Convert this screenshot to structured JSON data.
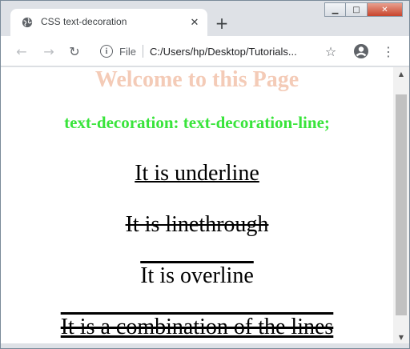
{
  "browser": {
    "tab_title": "CSS text-decoration",
    "tab_close": "✕",
    "new_tab": "+",
    "window_controls": {
      "minimize": "▁",
      "maximize": "□",
      "close": "✕"
    }
  },
  "toolbar": {
    "back": "←",
    "forward": "→",
    "reload": "↻",
    "info": "i",
    "scheme_label": "File",
    "url": "C:/Users/hp/Desktop/Tutorials...",
    "bookmark": "☆",
    "menu": "⋮"
  },
  "page": {
    "heading": "Welcome to this Page",
    "subheading": "text-decoration: text-decoration-line;",
    "underline_text": "It is underline",
    "linethrough_text": "It is linethrough",
    "overline_text": "It is overline",
    "combo_text": "It is a combination of the lines"
  },
  "colors": {
    "heading": "#f4cbb7",
    "subheading": "#39e43b",
    "tab_bg": "#ffffff",
    "chrome_bg": "#dee1e6"
  },
  "scrollbar": {
    "up": "▲",
    "down": "▼"
  }
}
